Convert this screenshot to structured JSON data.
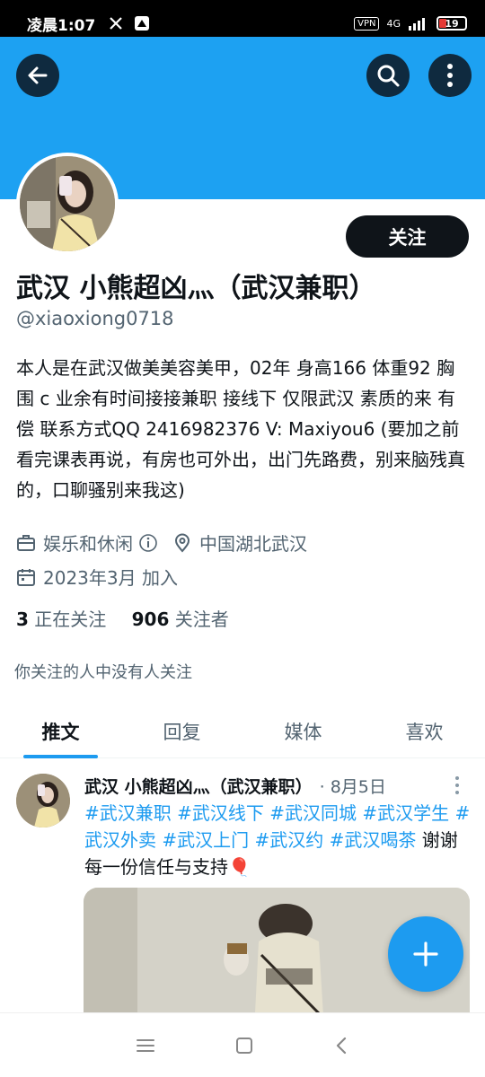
{
  "status_bar": {
    "time": "凌晨1:07",
    "network": "4G",
    "vpn": "VPN",
    "battery": "19"
  },
  "header": {
    "back_icon": "arrow-left-icon",
    "search_icon": "search-icon",
    "more_icon": "more-vertical-icon",
    "banner_color": "#1da1f2"
  },
  "profile": {
    "follow_label": "关注",
    "display_name": "武汉 小熊超凶灬（武汉兼职）",
    "handle": "@xiaoxiong0718",
    "bio": "本人是在武汉做美美容美甲，02年  身高166  体重92  胸围 c  业余有时间接接兼职    接线下 仅限武汉  素质的来  有偿  联系方式QQ    2416982376 V: Maxiyou6 (要加之前看完课表再说，有房也可外出，出门先路费，别来脑残真的，口聊骚别来我这)",
    "category": "娱乐和休闲",
    "location": "中国湖北武汉",
    "joined": "2023年3月 加入",
    "following_count": "3",
    "following_label": "正在关注",
    "followers_count": "906",
    "followers_label": "关注者",
    "followers_note": "你关注的人中没有人关注"
  },
  "tabs": [
    {
      "label": "推文",
      "active": true
    },
    {
      "label": "回复",
      "active": false
    },
    {
      "label": "媒体",
      "active": false
    },
    {
      "label": "喜欢",
      "active": false
    }
  ],
  "tweet": {
    "author": "武汉 小熊超凶灬（武汉兼职）",
    "date": "· 8月5日",
    "hashtags": [
      "#武汉兼职",
      "#武汉线下",
      "#武汉同城",
      "#武汉学生",
      "#武汉外卖",
      "#武汉上门",
      "#武汉约",
      "#武汉喝茶"
    ],
    "text": "谢谢每一份信任与支持🎈"
  },
  "colors": {
    "accent": "#1d9bf0",
    "text": "#0f1419",
    "muted": "#536471"
  }
}
